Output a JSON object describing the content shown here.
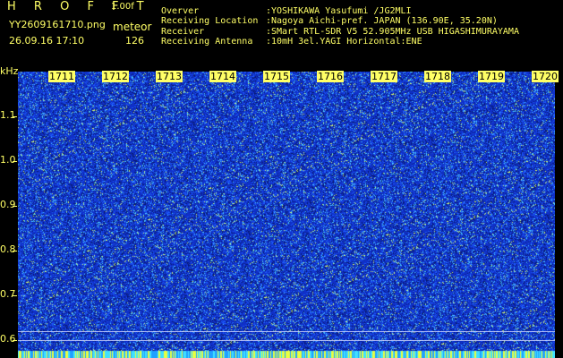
{
  "header": {
    "title": "H R O F F T",
    "version": "1.00f",
    "filename": "YY2609161710.png",
    "mode": "meteor",
    "datetime": "26.09.16 17:10",
    "count": "126"
  },
  "station": [
    {
      "key": "Overver",
      "value": ":YOSHIKAWA Yasufumi /JG2MLI"
    },
    {
      "key": "Receiving Location",
      "value": ":Nagoya Aichi-pref. JAPAN (136.90E, 35.20N)"
    },
    {
      "key": "Receiver",
      "value": ":SMart RTL-SDR V5 52.905MHz USB HIGASHIMURAYAMA"
    },
    {
      "key": "Receiving Antenna",
      "value": ":10mH 3el.YAGI Horizontal:ENE"
    }
  ],
  "spectrogram": {
    "y_unit": "kHz",
    "y_ticks": [
      "1.1",
      "1.0",
      "0.9",
      "0.8",
      "0.7",
      "0.6"
    ],
    "time_labels": [
      "1711",
      "1712",
      "1713",
      "1714",
      "1715",
      "1716",
      "1717",
      "1718",
      "1719",
      "1720"
    ],
    "colors": {
      "background": "#1030c8",
      "noise_dim": "#1e5cff",
      "noise_bright": "#4fd0ff",
      "noise_hot": "#d8ff70",
      "label": "#ffff66"
    }
  }
}
